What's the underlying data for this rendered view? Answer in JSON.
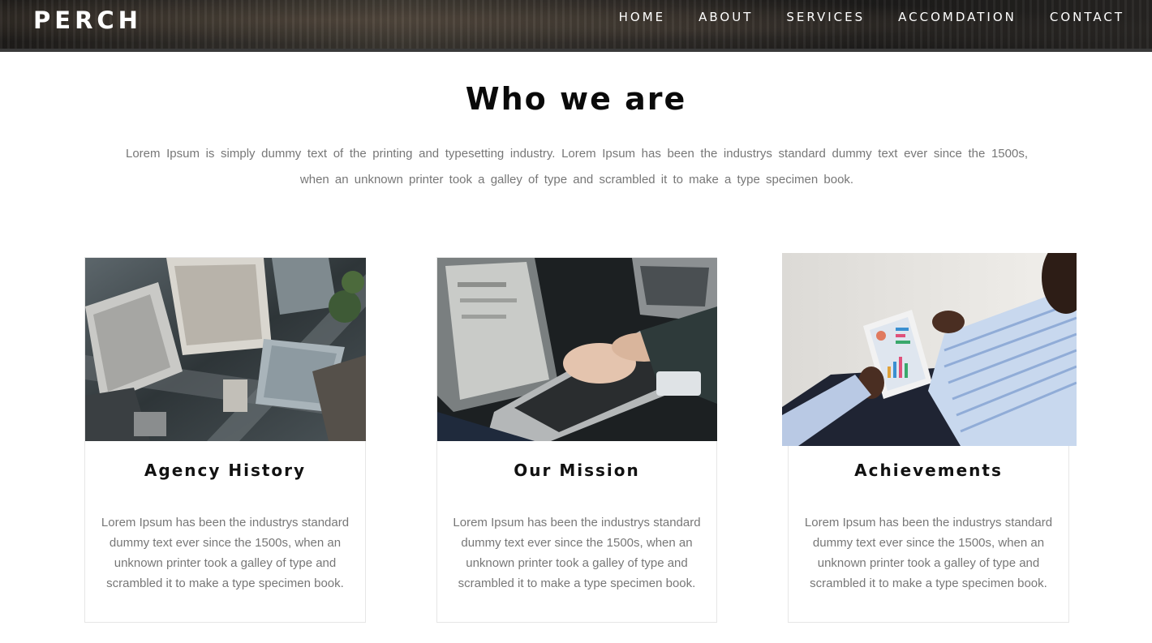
{
  "header": {
    "brand": "PERCH",
    "nav": [
      {
        "label": "HOME"
      },
      {
        "label": "ABOUT"
      },
      {
        "label": "SERVICES"
      },
      {
        "label": "ACCOMDATION"
      },
      {
        "label": "CONTACT"
      }
    ]
  },
  "about": {
    "title": "Who we are",
    "intro": "Lorem Ipsum is simply dummy text of the printing and typesetting industry. Lorem Ipsum has been the industrys standard dummy text ever since the 1500s, when an unknown printer took a galley of type and scrambled it to make a type specimen book."
  },
  "cards": [
    {
      "title": "Agency History",
      "text": "Lorem Ipsum has been the industrys standard dummy text ever since the 1500s, when an unknown printer took a galley of type and scrambled it to make a type specimen book.",
      "image": "aerial-city-photo"
    },
    {
      "title": "Our Mission",
      "text": "Lorem Ipsum has been the industrys standard dummy text ever since the 1500s, when an unknown printer took a galley of type and scrambled it to make a type specimen book.",
      "image": "laptop-typing-photo"
    },
    {
      "title": "Achievements",
      "text": "Lorem Ipsum has been the industrys standard dummy text ever since the 1500s, when an unknown printer took a galley of type and scrambled it to make a type specimen book.",
      "image": "tablet-chart-photo"
    }
  ],
  "colors": {
    "text_dark": "#111111",
    "text_muted": "#777777",
    "card_border": "#e6e6e6",
    "nav_text": "#ffffff"
  }
}
